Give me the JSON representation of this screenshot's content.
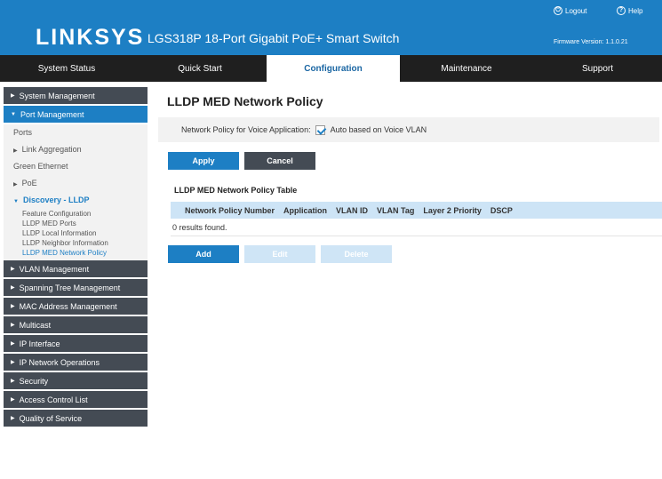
{
  "header": {
    "brand": "LINKSYS",
    "product": "LGS318P 18-Port Gigabit PoE+ Smart Switch",
    "logout": "Logout",
    "help": "Help",
    "firmware": "Firmware Version: 1.1.0.21",
    "bg_color": "#1d7fc4"
  },
  "nav": {
    "tabs": [
      {
        "label": "System Status"
      },
      {
        "label": "Quick Start"
      },
      {
        "label": "Configuration"
      },
      {
        "label": "Maintenance"
      },
      {
        "label": "Support"
      }
    ],
    "active": "Configuration"
  },
  "sidebar": {
    "system_management": "System Management",
    "port_management": "Port Management",
    "port_items": [
      {
        "label": "Ports"
      },
      {
        "label": "Link Aggregation"
      },
      {
        "label": "Green Ethernet"
      },
      {
        "label": "PoE"
      },
      {
        "label": "Discovery - LLDP"
      }
    ],
    "lldp_items": [
      {
        "label": "Feature Configuration"
      },
      {
        "label": "LLDP MED Ports"
      },
      {
        "label": "LLDP Local Information"
      },
      {
        "label": "LLDP Neighbor Information"
      },
      {
        "label": "LLDP MED Network Policy"
      }
    ],
    "sections": [
      {
        "label": "VLAN Management"
      },
      {
        "label": "Spanning Tree Management"
      },
      {
        "label": "MAC Address Management"
      },
      {
        "label": "Multicast"
      },
      {
        "label": "IP Interface"
      },
      {
        "label": "IP Network Operations"
      },
      {
        "label": "Security"
      },
      {
        "label": "Access Control List"
      },
      {
        "label": "Quality of Service"
      }
    ]
  },
  "main": {
    "title": "LLDP MED Network Policy",
    "policy_label": "Network Policy for Voice Application:",
    "policy_checkbox_label": "Auto based on Voice VLAN",
    "policy_checked": true,
    "apply": "Apply",
    "cancel": "Cancel",
    "table_title": "LLDP MED Network Policy Table",
    "columns": [
      "Network Policy Number",
      "Application",
      "VLAN ID",
      "VLAN Tag",
      "Layer 2 Priority",
      "DSCP"
    ],
    "results": "0 results found.",
    "add": "Add",
    "edit": "Edit",
    "delete": "Delete"
  }
}
